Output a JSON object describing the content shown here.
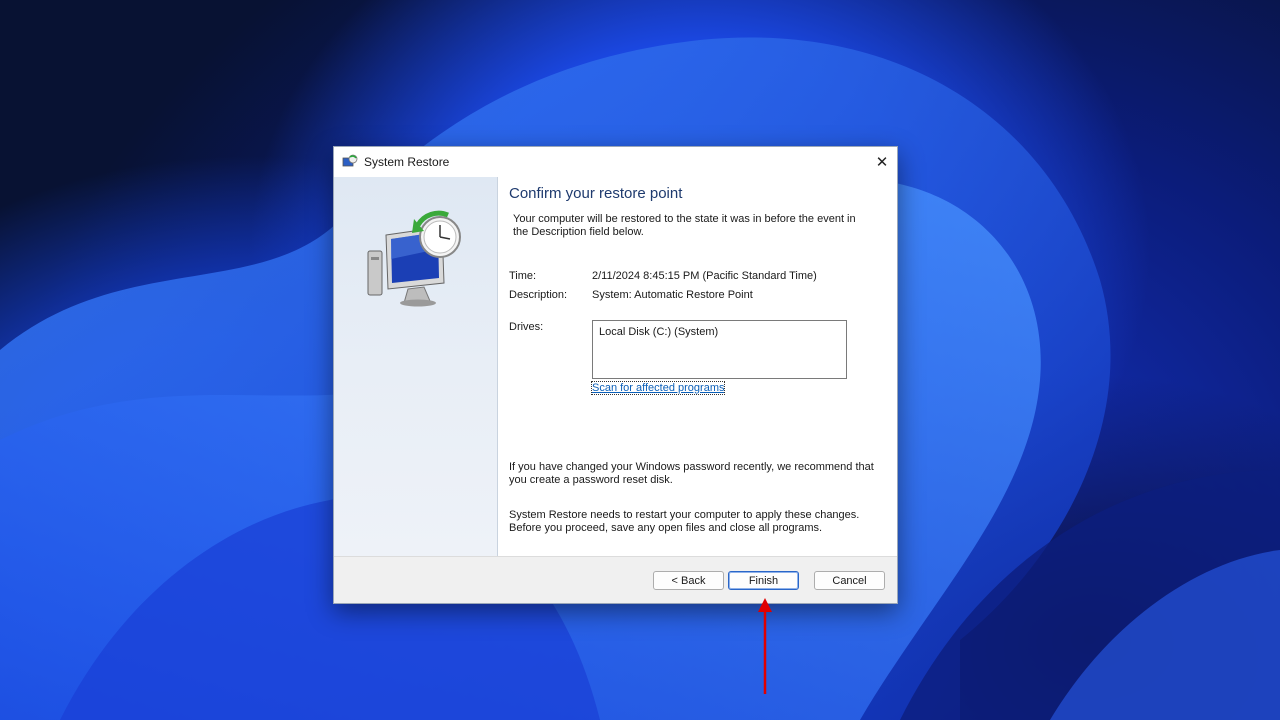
{
  "window": {
    "title": "System Restore",
    "close_glyph": "✕"
  },
  "icons": {
    "title_icon": "system-restore-icon",
    "hero_icon": "computer-restore-clock-icon"
  },
  "content": {
    "heading": "Confirm your restore point",
    "intro": "Your computer will be restored to the state it was in before the event in the Description field below.",
    "time_label": "Time:",
    "time_value": "2/11/2024 8:45:15 PM (Pacific Standard Time)",
    "description_label": "Description:",
    "description_value": "System: Automatic Restore Point",
    "drives_label": "Drives:",
    "drives": [
      "Local Disk (C:) (System)"
    ],
    "scan_link": "Scan for affected programs",
    "password_note": "If you have changed your Windows password recently, we recommend that you create a password reset disk.",
    "restart_note": "System Restore needs to restart your computer to apply these changes. Before you proceed, save any open files and close all programs."
  },
  "buttons": {
    "back": "< Back",
    "finish": "Finish",
    "cancel": "Cancel"
  },
  "colors": {
    "accent": "#2a66c8",
    "link": "#0b5fb8",
    "annotation_arrow": "#e00000"
  }
}
